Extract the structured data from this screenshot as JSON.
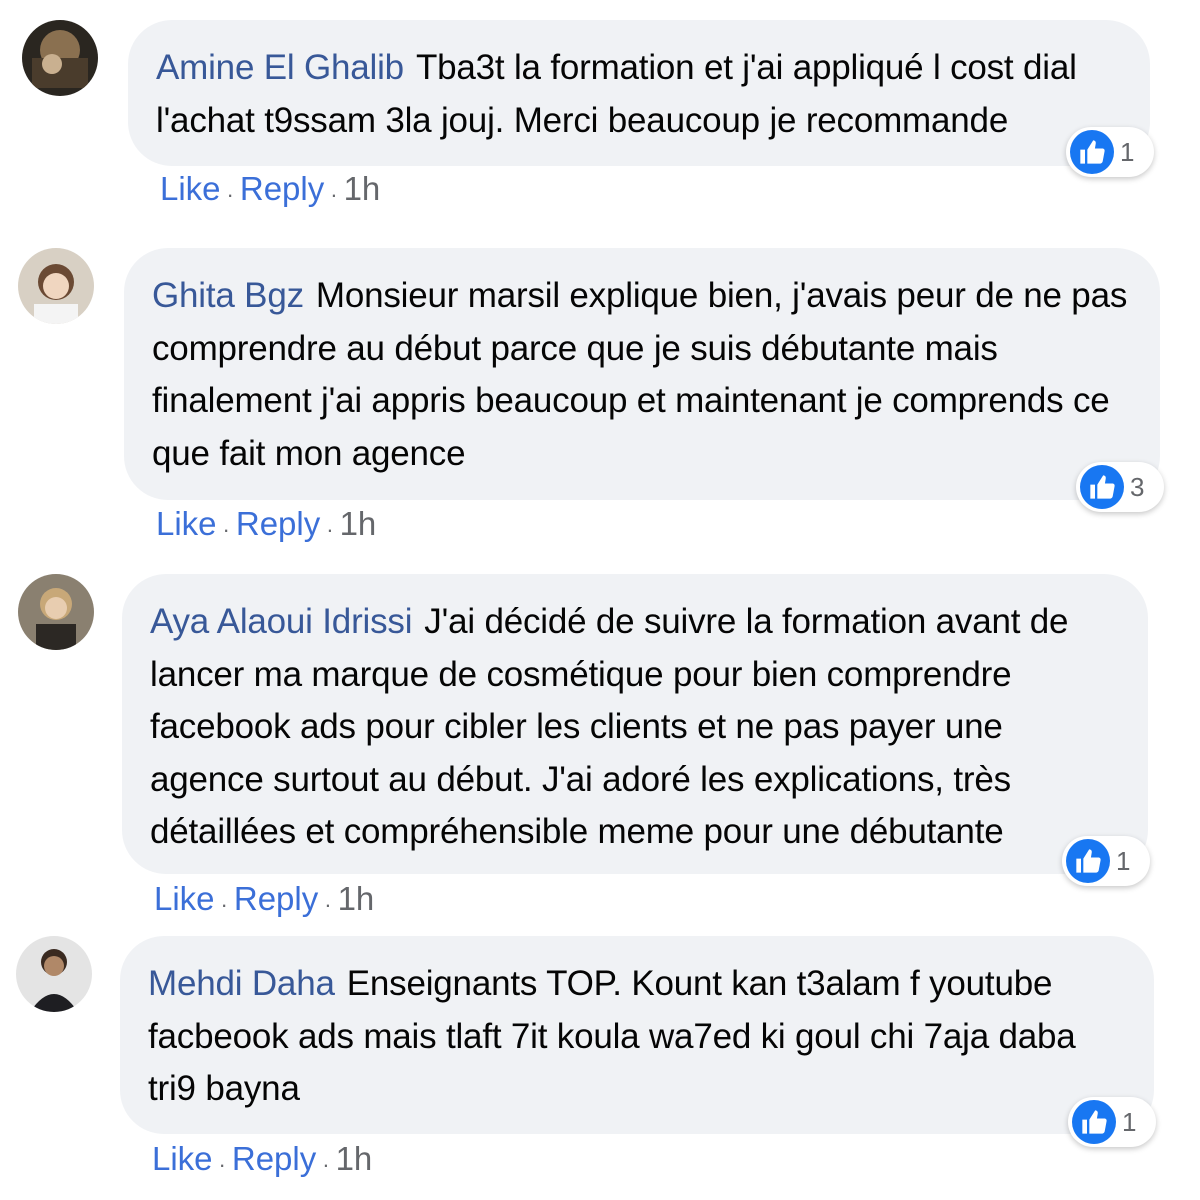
{
  "comments": [
    {
      "author": "Amine El Ghalib",
      "text": "Tba3t la formation et j'ai appliqué l cost dial l'achat t9ssam 3la jouj. Merci beaucoup je recommande",
      "reaction_icon": "like-icon",
      "reaction_count": "1",
      "like_label": "Like",
      "reply_label": "Reply",
      "separator": "·",
      "time": "1h"
    },
    {
      "author": "Ghita Bgz",
      "text": "Monsieur marsil explique bien, j'avais peur de ne pas comprendre au début parce que je suis débutante mais finalement j'ai appris beaucoup et maintenant je comprends ce que fait mon agence",
      "reaction_icon": "like-icon",
      "reaction_count": "3",
      "like_label": "Like",
      "reply_label": "Reply",
      "separator": "·",
      "time": "1h"
    },
    {
      "author": "Aya Alaoui Idrissi",
      "text": "J'ai décidé de suivre la formation avant de lancer ma marque de cosmétique pour bien comprendre facebook ads pour cibler les clients et ne pas payer une agence surtout au début. J'ai adoré les explications, très détaillées et compréhensible meme pour une débutante",
      "reaction_icon": "like-icon",
      "reaction_count": "1",
      "like_label": "Like",
      "reply_label": "Reply",
      "separator": "·",
      "time": "1h"
    },
    {
      "author": "Mehdi Daha",
      "text": "Enseignants TOP. Kount kan t3alam f youtube facbeook ads mais tlaft 7it koula wa7ed ki goul chi 7aja daba tri9 bayna",
      "reaction_icon": "like-icon",
      "reaction_count": "1",
      "like_label": "Like",
      "reply_label": "Reply",
      "separator": "·",
      "time": "1h"
    }
  ],
  "colors": {
    "author": "#385898",
    "link": "#3b6fd8",
    "bubble": "#f0f2f5",
    "like_blue": "#1877f2",
    "meta": "#65676b"
  }
}
